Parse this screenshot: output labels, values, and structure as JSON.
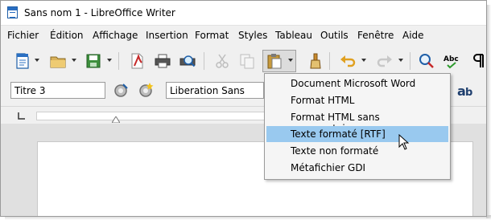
{
  "window": {
    "title": "Sans nom 1 - LibreOffice Writer"
  },
  "menubar": [
    "Fichier",
    "Édition",
    "Affichage",
    "Insertion",
    "Format",
    "Styles",
    "Tableau",
    "Outils",
    "Fenêtre",
    "Aide"
  ],
  "toolbar2": {
    "paragraph_style": "Titre 3",
    "font_name": "Liberation Sans"
  },
  "paste_special_menu": {
    "items": [
      "Document Microsoft Word",
      "Format HTML",
      "Format HTML sans commentaires",
      "Texte formaté [RTF]",
      "Texte non formaté",
      "Métafichier GDI"
    ],
    "selected_index": 3
  },
  "colors": {
    "highlight": "#99c9ef",
    "menu_bg": "#f5f5f5",
    "toolbar_bg": "#f0f0f0"
  },
  "icons": {
    "toolbar1": [
      "new-document-icon",
      "open-folder-icon",
      "save-icon",
      "export-pdf-icon",
      "print-icon",
      "print-preview-icon",
      "cut-icon",
      "copy-icon",
      "paste-icon",
      "clone-formatting-icon",
      "undo-icon",
      "redo-icon",
      "find-replace-icon",
      "spellcheck-icon",
      "formatting-marks-icon"
    ],
    "toolbar2": [
      "update-style-icon",
      "new-style-icon",
      "font-size-icon"
    ]
  }
}
